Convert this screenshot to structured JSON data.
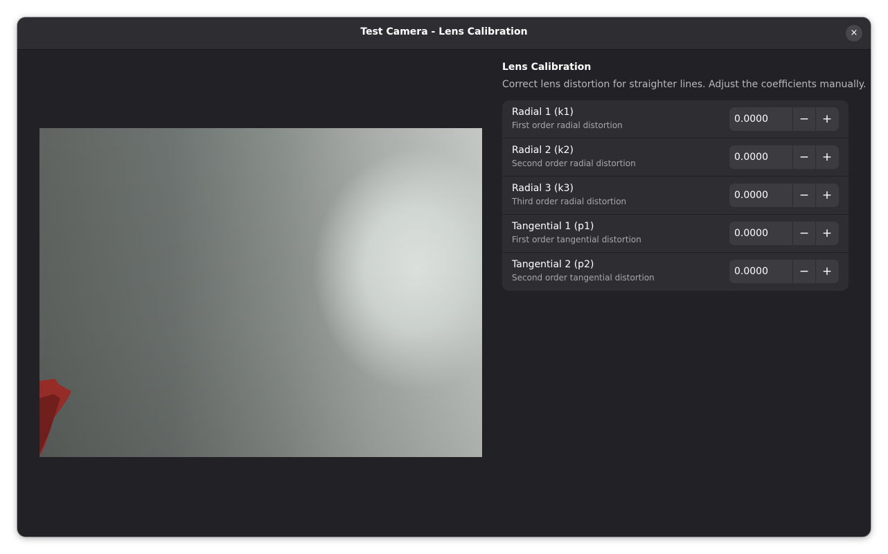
{
  "window": {
    "title": "Test Camera - Lens Calibration",
    "close_icon": "×"
  },
  "panel": {
    "heading": "Lens Calibration",
    "description": "Correct lens distortion for straighter lines. Adjust the coefficients manually."
  },
  "spin_icons": {
    "minus": "−",
    "plus": "+"
  },
  "coefficients": [
    {
      "title": "Radial 1 (k1)",
      "subtitle": "First order radial distortion",
      "value": "0.0000"
    },
    {
      "title": "Radial 2 (k2)",
      "subtitle": "Second order radial distortion",
      "value": "0.0000"
    },
    {
      "title": "Radial 3 (k3)",
      "subtitle": "Third order radial distortion",
      "value": "0.0000"
    },
    {
      "title": "Tangential 1 (p1)",
      "subtitle": "First order tangential distortion",
      "value": "0.0000"
    },
    {
      "title": "Tangential 2 (p2)",
      "subtitle": "Second order tangential distortion",
      "value": "0.0000"
    }
  ]
}
